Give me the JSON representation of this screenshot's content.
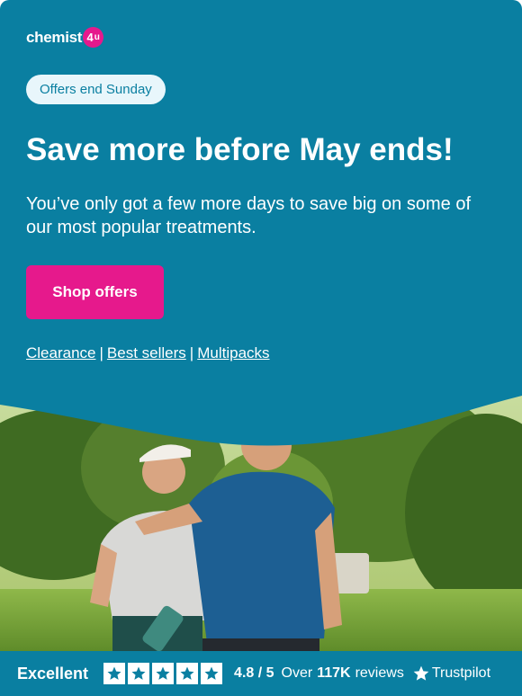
{
  "brand": {
    "name": "chemist",
    "badge": "4",
    "badge_suffix": "u",
    "accent": "#e6198c",
    "background": "#0a7fa1"
  },
  "promo": {
    "pill": "Offers end Sunday"
  },
  "headline": "Save more before May ends!",
  "subtext": "You’ve only got a few more days to save big on some of our most popular treatments.",
  "cta": {
    "label": "Shop offers",
    "color": "#e6198c"
  },
  "links": [
    {
      "label": "Clearance"
    },
    {
      "label": "Best sellers"
    },
    {
      "label": "Multipacks"
    }
  ],
  "link_separator": "|",
  "hero": {
    "icon": "couple-walking-photo"
  },
  "trustbar": {
    "excellent": "Excellent",
    "stars": 5,
    "rating": "4.8 / 5",
    "over": "Over",
    "count": "117K",
    "reviews": "reviews",
    "provider": "Trustpilot",
    "star_color": "#0a7fa1"
  }
}
